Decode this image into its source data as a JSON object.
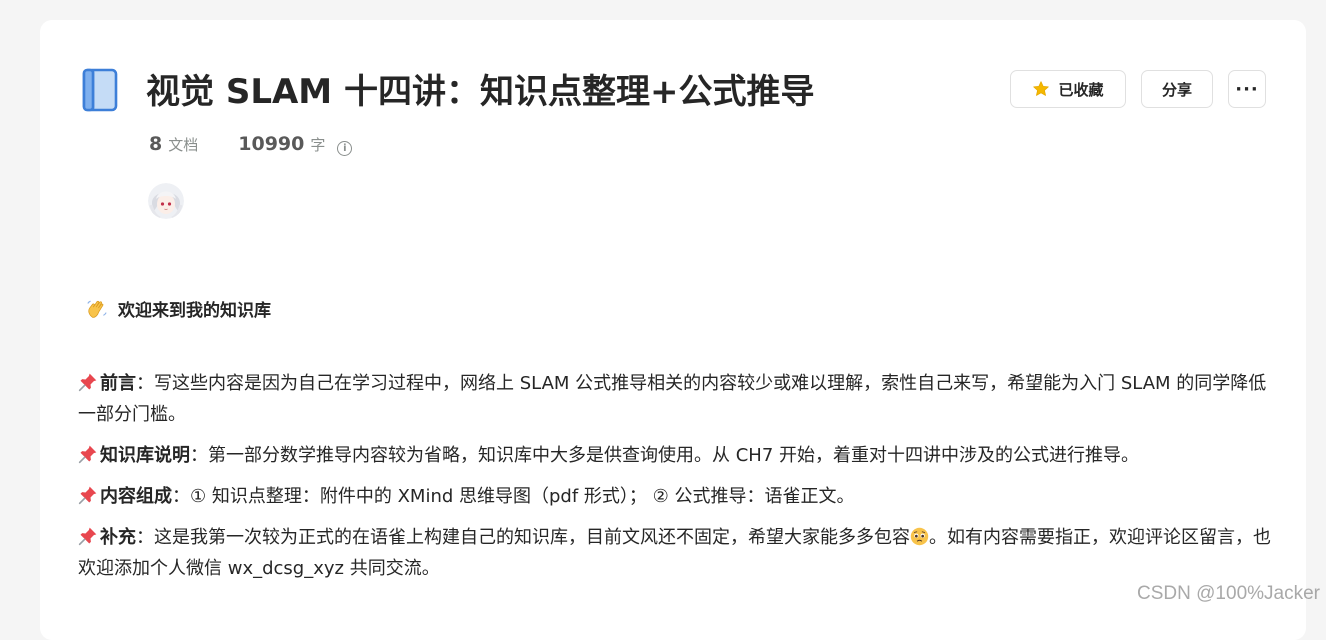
{
  "header": {
    "title": "视觉 SLAM 十四讲：知识点整理+公式推导",
    "book_icon": "book-icon"
  },
  "actions": {
    "collect_label": "已收藏",
    "collect_icon": "star-icon",
    "share_label": "分享",
    "more_label": "···"
  },
  "stats": {
    "docs_count": "8",
    "docs_unit": "文档",
    "words_count": "10990",
    "words_unit": "字",
    "info_icon": "info-icon"
  },
  "avatar": {
    "icon": "user-avatar"
  },
  "welcome": {
    "icon": "waving-hand-icon",
    "text": "欢迎来到我的知识库"
  },
  "sections": [
    {
      "heading": "前言",
      "body": "：写这些内容是因为自己在学习过程中，网络上 SLAM 公式推导相关的内容较少或难以理解，索性自己来写，希望能为入门 SLAM 的同学降低一部分门槛。",
      "body_after_emoji": ""
    },
    {
      "heading": "知识库说明",
      "body": "：第一部分数学推导内容较为省略，知识库中大多是供查询使用。从 CH7 开始，着重对十四讲中涉及的公式进行推导。",
      "body_after_emoji": ""
    },
    {
      "heading": "内容组成",
      "body": "：① 知识点整理：附件中的 XMind 思维导图（pdf 形式）； ② 公式推导：语雀正文。",
      "body_after_emoji": ""
    },
    {
      "heading": "补充",
      "body": "：这是我第一次较为正式的在语雀上构建自己的知识库，目前文风还不固定，希望大家能多多包容",
      "body_after_emoji": "。如有内容需要指正，欢迎评论区留言，也欢迎添加个人微信 wx_dcsg_xyz 共同交流。"
    }
  ],
  "watermark": "CSDN @100%Jacker",
  "colors": {
    "star": "#f5b800",
    "book_fill": "#c5dcf6",
    "book_stroke": "#3d7fd8",
    "pin": "#e8474f"
  }
}
